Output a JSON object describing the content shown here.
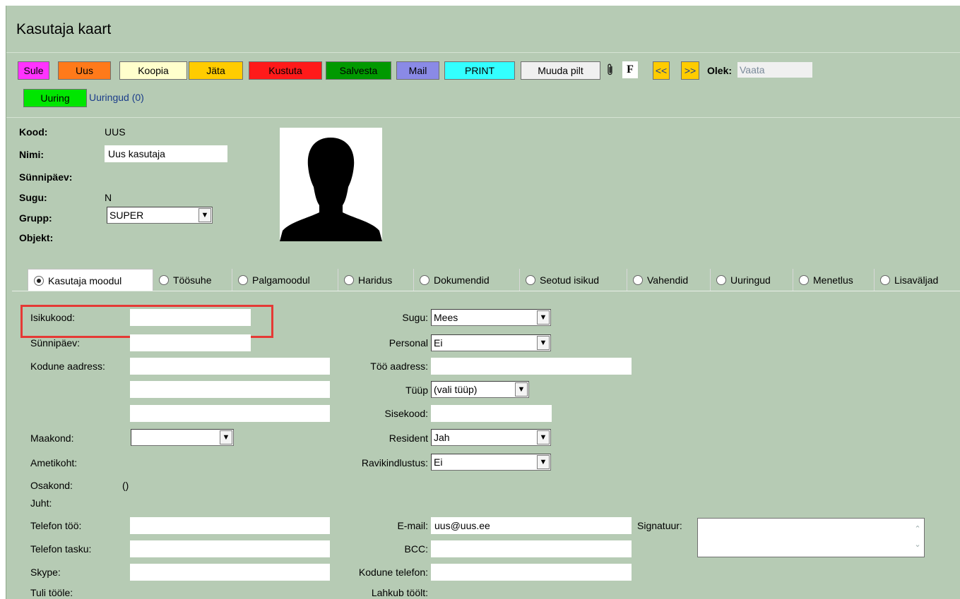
{
  "page": {
    "title": "Kasutaja kaart"
  },
  "toolbar": {
    "buttons": [
      {
        "label": "Sule",
        "color": "#ff33ff"
      },
      {
        "label": "Uus",
        "color": "#ff7a1a"
      },
      {
        "label": "Koopia",
        "color": "#ffffcc"
      },
      {
        "label": "Jäta",
        "color": "#ffcc00"
      },
      {
        "label": "Kustuta",
        "color": "#ff1a1a"
      },
      {
        "label": "Salvesta",
        "color": "#009900"
      },
      {
        "label": "Mail",
        "color": "#8a8ae6"
      },
      {
        "label": "PRINT",
        "color": "#33ffff"
      },
      {
        "label": "Muuda pilt",
        "color": "#f0f0f0"
      }
    ],
    "attach_icon": "paperclip-icon",
    "f_label": "F",
    "prev_label": "<<",
    "next_label": ">>",
    "olek_label": "Olek:",
    "olek_value": "Vaata",
    "uuring_label": "Uuring",
    "uuringud_link": "Uuringud (0)"
  },
  "header": {
    "kood_label": "Kood:",
    "kood_value": "UUS",
    "nimi_label": "Nimi:",
    "nimi_value": "Uus kasutaja",
    "synnipaev_label": "Sünnipäev:",
    "sugu_label": "Sugu:",
    "sugu_value": "N",
    "grupp_label": "Grupp:",
    "grupp_value": "SUPER",
    "objekt_label": "Objekt:",
    "photo_icon": "person-silhouette-icon"
  },
  "tabs": [
    {
      "label": "Kasutaja moodul",
      "selected": true
    },
    {
      "label": "Töösuhe",
      "selected": false
    },
    {
      "label": "Palgamoodul",
      "selected": false
    },
    {
      "label": "Haridus",
      "selected": false
    },
    {
      "label": "Dokumendid",
      "selected": false
    },
    {
      "label": "Seotud isikud",
      "selected": false
    },
    {
      "label": "Vahendid",
      "selected": false
    },
    {
      "label": "Uuringud",
      "selected": false
    },
    {
      "label": "Menetlus",
      "selected": false
    },
    {
      "label": "Lisaväljad",
      "selected": false
    }
  ],
  "form": {
    "isikukood_label": "Isikukood:",
    "synnipaev_label": "Sünnipäev:",
    "kodune_aadress_label": "Kodune aadress:",
    "maakond_label": "Maakond:",
    "ametikoht_label": "Ametikoht:",
    "osakond_label": "Osakond:",
    "osakond_value": "()",
    "juht_label": "Juht:",
    "telefon_too_label": "Telefon töö:",
    "telefon_tasku_label": "Telefon tasku:",
    "skype_label": "Skype:",
    "tuli_toole_label": "Tuli tööle:",
    "sugu_label": "Sugu:",
    "sugu_value": "Mees",
    "personal_label": "Personal",
    "personal_value": "Ei",
    "too_aadress_label": "Töö aadress:",
    "tyyp_label": "Tüüp",
    "tyyp_value": "(vali tüüp)",
    "sisekood_label": "Sisekood:",
    "resident_label": "Resident",
    "resident_value": "Jah",
    "ravikindlustus_label": "Ravikindlustus:",
    "ravikindlustus_value": "Ei",
    "email_label": "E-mail:",
    "email_value": "uus@uus.ee",
    "bcc_label": "BCC:",
    "kodune_telefon_label": "Kodune telefon:",
    "lahkub_label": "Lahkub töölt:",
    "signatuur_label": "Signatuur:"
  }
}
